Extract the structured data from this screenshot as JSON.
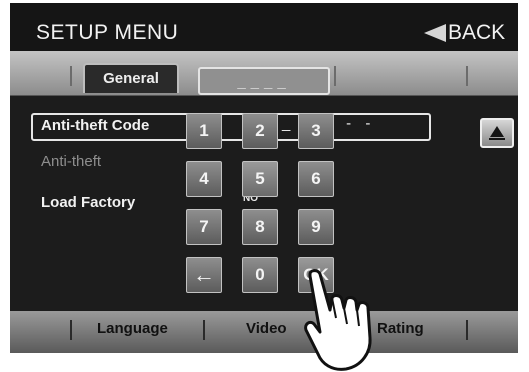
{
  "header": {
    "title": "SETUP MENU",
    "back_label": "BACK"
  },
  "tabs": [
    {
      "label": "General",
      "active": true
    },
    {
      "label": "____",
      "active": false
    }
  ],
  "rows": {
    "antitheft_code": {
      "label": "Anti-theft Code",
      "value": "_ _ - - -"
    },
    "antitheft": {
      "label": "Anti-theft"
    },
    "load_factory": {
      "label": "Load Factory",
      "value_fragment": "NO"
    }
  },
  "keypad": {
    "keys": [
      "1",
      "2",
      "3",
      "4",
      "5",
      "6",
      "7",
      "8",
      "9",
      "←",
      "0",
      "OK"
    ],
    "pressed_key": "OK"
  },
  "bottom_tabs": [
    {
      "label": "Language"
    },
    {
      "label": "Video"
    },
    {
      "label": "Rating"
    }
  ],
  "icons": {
    "back": "left-arrow-icon",
    "scroll": "arrow-up-icon",
    "backspace": "left-arrow-key-icon",
    "hand": "pointing-hand-icon"
  },
  "colors": {
    "background": "#1c1c1c",
    "tab_strip": "#a8a8a8",
    "key_face": "#707070",
    "text": "#f1f1f1",
    "dim_text": "#8e8e8e"
  }
}
